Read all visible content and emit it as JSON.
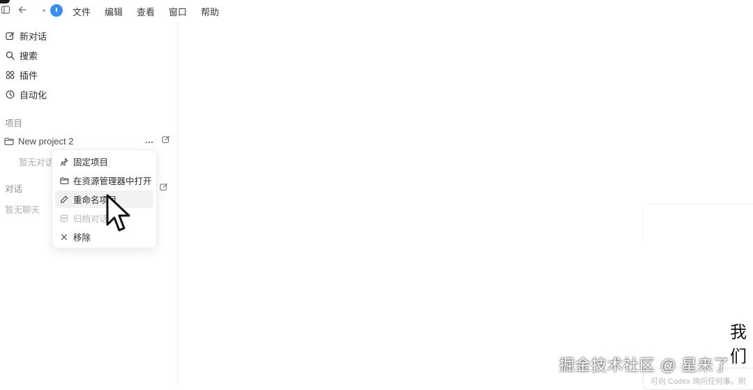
{
  "menubar": {
    "items": [
      "文件",
      "编辑",
      "查看",
      "窗口",
      "帮助"
    ]
  },
  "sidebar": {
    "nav": [
      {
        "label": "新对话",
        "icon": "edit-icon"
      },
      {
        "label": "搜索",
        "icon": "search-icon"
      },
      {
        "label": "插件",
        "icon": "grid-icon"
      },
      {
        "label": "自动化",
        "icon": "clock-icon"
      }
    ],
    "projects_heading": "项目",
    "project_name": "New project 2",
    "project_empty": "暂无对话",
    "chats_heading": "对话",
    "chats_empty": "暂无聊天"
  },
  "context_menu": {
    "items": [
      {
        "label": "固定项目",
        "icon": "pin-icon"
      },
      {
        "label": "在资源管理器中打开",
        "icon": "folder-icon"
      },
      {
        "label": "重命名项目",
        "icon": "pencil-icon"
      },
      {
        "label": "归档对话",
        "icon": "archive-icon"
      },
      {
        "label": "移除",
        "icon": "close-icon"
      }
    ]
  },
  "main": {
    "heading_partial": "我们",
    "input_placeholder": "可向 Codex 询问任何事。附",
    "watermark": "掘金技术社区 @ 星来了"
  }
}
